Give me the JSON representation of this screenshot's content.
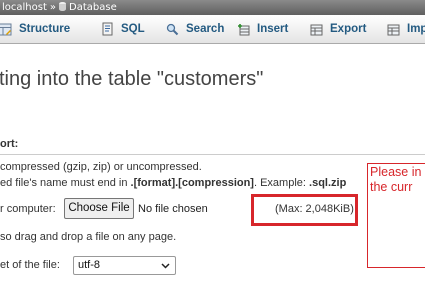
{
  "breadcrumb": {
    "server": "localhost",
    "separator": "»",
    "database": "Database"
  },
  "tabs": [
    {
      "label": "Structure",
      "icon": "structure-icon"
    },
    {
      "label": "SQL",
      "icon": "sql-icon"
    },
    {
      "label": "Search",
      "icon": "search-icon"
    },
    {
      "label": "Insert",
      "icon": "insert-icon"
    },
    {
      "label": "Export",
      "icon": "export-icon"
    },
    {
      "label": "Imp",
      "icon": "import-icon"
    }
  ],
  "page": {
    "title": "ting into the table \"customers\""
  },
  "import_section": {
    "heading": "ort:",
    "compression_line": "compressed (gzip, zip) or uncompressed.",
    "filename_prefix": "ed file's name must end in ",
    "filename_format": ".[format].[compression]",
    "filename_example_prefix": ". Example: ",
    "filename_example": ".sql.zip",
    "browse_label": "r computer:",
    "choose_file_button": "Choose File",
    "no_file_text": "No file chosen",
    "max_size": "(Max: 2,048KiB)",
    "drag_drop_text": "so drag and drop a file on any page.",
    "charset_label": "et of the file:",
    "charset_value": "utf-8"
  },
  "notice": {
    "line1": "Please in",
    "line2": "the curr"
  },
  "colors": {
    "tab_text": "#235a81",
    "highlight_red": "#d7262b"
  }
}
